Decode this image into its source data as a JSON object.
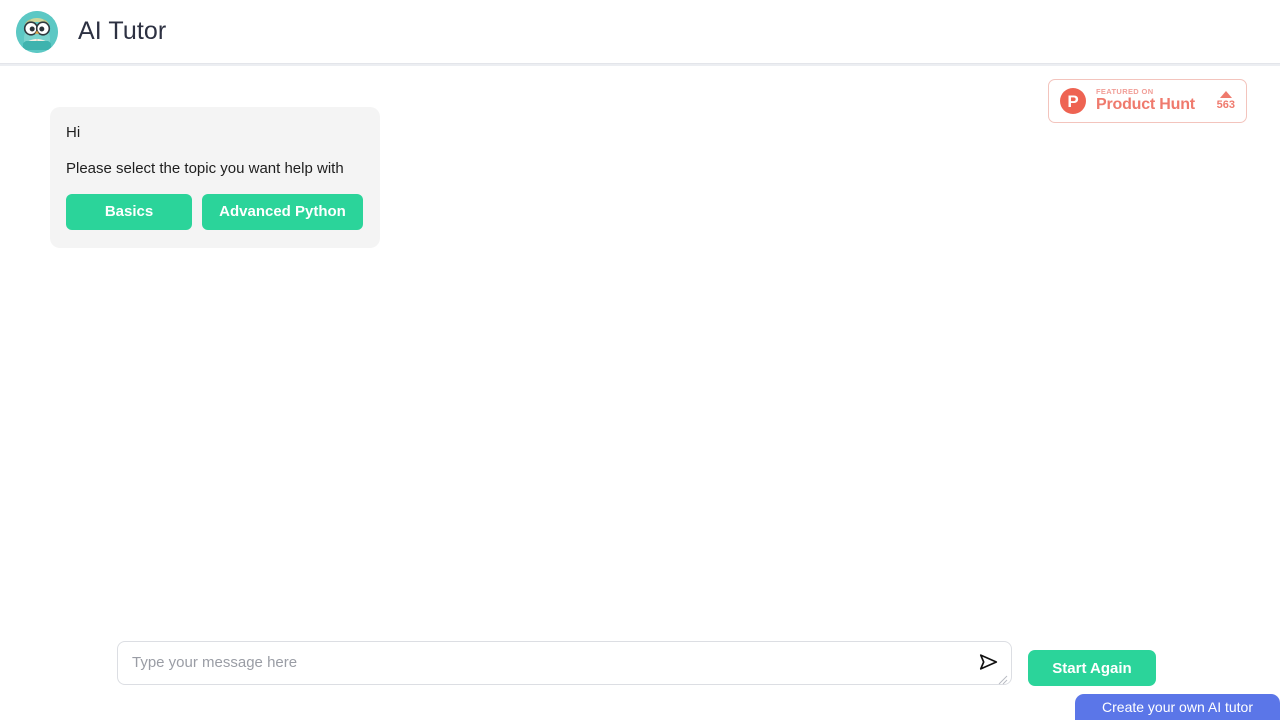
{
  "header": {
    "title": "AI Tutor",
    "logo_icon": "owl-avatar-icon"
  },
  "product_hunt": {
    "mark": "P",
    "featured_label": "FEATURED ON",
    "name": "Product Hunt",
    "upvote_icon": "upvote-caret-icon",
    "upvotes": "563",
    "accent_color": "#ef7a6d"
  },
  "chat": {
    "message": {
      "greeting": "Hi",
      "prompt": "Please select the topic you want help with",
      "options": [
        {
          "label": "Basics"
        },
        {
          "label": "Advanced Python"
        }
      ]
    }
  },
  "composer": {
    "placeholder": "Type your message here",
    "value": "",
    "send_icon": "send-paper-plane-icon",
    "resize_icon": "resize-grip-icon",
    "start_again_label": "Start Again",
    "accent_color": "#2bd49a"
  },
  "footer": {
    "create_tab_label": "Create your own AI tutor",
    "accent_color": "#5b76e8"
  }
}
